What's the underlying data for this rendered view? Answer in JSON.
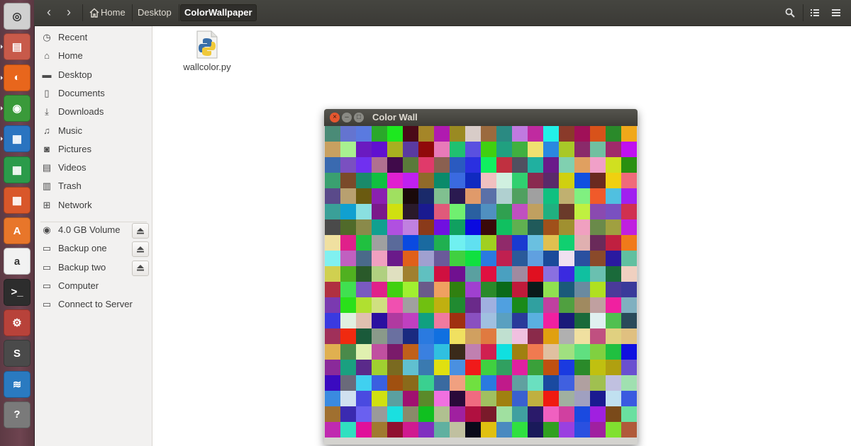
{
  "launcher": {
    "apps": [
      {
        "name": "ubuntu-logo-icon",
        "color": "#d0d0d0"
      },
      {
        "name": "file-manager-icon",
        "color": "#c85a4a"
      },
      {
        "name": "firefox-icon",
        "color": "#e8661c"
      },
      {
        "name": "chrome-icon",
        "color": "#3a9a3a"
      },
      {
        "name": "writer-icon",
        "color": "#2a74c0"
      },
      {
        "name": "calc-icon",
        "color": "#2b9b4a"
      },
      {
        "name": "impress-icon",
        "color": "#d9572a"
      },
      {
        "name": "software-center-icon",
        "color": "#e8762a"
      },
      {
        "name": "amazon-icon",
        "color": "#f2f2f2"
      },
      {
        "name": "terminal-icon",
        "color": "#2d2d2d"
      },
      {
        "name": "system-settings-icon",
        "color": "#b8423a"
      },
      {
        "name": "sublime-text-icon",
        "color": "#4a4a4a"
      },
      {
        "name": "system-monitor-icon",
        "color": "#2a7ac0"
      },
      {
        "name": "unknown-app-icon",
        "color": "#7a7a7a"
      }
    ]
  },
  "toolbar": {
    "breadcrumbs": [
      {
        "label": "Home"
      },
      {
        "label": "Desktop"
      },
      {
        "label": "ColorWallpaper"
      }
    ]
  },
  "sidebar": {
    "places": [
      {
        "label": "Recent",
        "icon": "clock-icon"
      },
      {
        "label": "Home",
        "icon": "home-icon"
      },
      {
        "label": "Desktop",
        "icon": "folder-icon"
      },
      {
        "label": "Documents",
        "icon": "document-icon"
      },
      {
        "label": "Downloads",
        "icon": "download-icon"
      },
      {
        "label": "Music",
        "icon": "music-icon"
      },
      {
        "label": "Pictures",
        "icon": "camera-icon"
      },
      {
        "label": "Videos",
        "icon": "film-icon"
      },
      {
        "label": "Trash",
        "icon": "trash-icon"
      },
      {
        "label": "Network",
        "icon": "network-icon"
      }
    ],
    "devices": [
      {
        "label": "4.0 GB Volume",
        "icon": "disk-icon"
      },
      {
        "label": "Backup one",
        "icon": "drive-icon"
      },
      {
        "label": "Backup two",
        "icon": "drive-icon"
      },
      {
        "label": "Computer",
        "icon": "drive-icon"
      },
      {
        "label": "Connect to Server",
        "icon": "server-icon"
      }
    ]
  },
  "main": {
    "files": [
      {
        "label": "wallcolor.py",
        "icon": "python-file-icon"
      }
    ]
  },
  "colorwall": {
    "title": "Color Wall",
    "grid_size": 20,
    "colors": [
      "#4a8b77",
      "#6474d0",
      "#5a7ae0",
      "#2aa82a",
      "#1de81f",
      "#4a0a18",
      "#a58628",
      "#b01ab0",
      "#9a8a22",
      "#d8ccc8",
      "#9b6a3e",
      "#2a8a82",
      "#c07ae0",
      "#c02aa0",
      "#22f0e8",
      "#8a3a2a",
      "#a01058",
      "#d8521a",
      "#2a8a2a",
      "#f0a81a",
      "#c8a060",
      "#a8f090",
      "#6a1ac0",
      "#6010d0",
      "#a8b020",
      "#5a3aa0",
      "#900a0a",
      "#e87ab8",
      "#20c070",
      "#5a50e0",
      "#40d010",
      "#20a080",
      "#40b040",
      "#f0e070",
      "#2a88e0",
      "#a8c828",
      "#8a2a6a",
      "#70c0a0",
      "#a02a6a",
      "#c010f0",
      "#3a6ab0",
      "#7a50c0",
      "#7030f0",
      "#b07090",
      "#400a4a",
      "#5a7a3a",
      "#e03a6a",
      "#8a6050",
      "#2a5ac0",
      "#2a30e0",
      "#10f060",
      "#c03040",
      "#505060",
      "#20b0a0",
      "#6a1a8a",
      "#80d0b0",
      "#e0a060",
      "#f0a0c8",
      "#d0e020",
      "#2a9010",
      "#3aa070",
      "#7a4a2a",
      "#1a8a6a",
      "#10c040",
      "#e020d0",
      "#c020f0",
      "#906a2a",
      "#0a8a6a",
      "#3a6ae0",
      "#102ac0",
      "#f0c0c0",
      "#d0f0e0",
      "#30d070",
      "#8a2a50",
      "#5a2a6a",
      "#d0d010",
      "#1050e0",
      "#6a2a20",
      "#f0d010",
      "#f06a7a",
      "#5a4a8a",
      "#b8a070",
      "#6a5a10",
      "#8a20b0",
      "#a0e060",
      "#1a0a0a",
      "#1a2a6a",
      "#80c090",
      "#2a1a50",
      "#e09a6a",
      "#5a70a8",
      "#b0d0d0",
      "#50a060",
      "#a0a0a0",
      "#10c080",
      "#c0b070",
      "#80f080",
      "#f05a2a",
      "#50c0e0",
      "#a020f0",
      "#3aa098",
      "#10a0d0",
      "#8ae0e0",
      "#7a1a8a",
      "#d0e010",
      "#2a1a2a",
      "#1a1a90",
      "#e05a7a",
      "#70f070",
      "#2a60a0",
      "#5090c0",
      "#30a050",
      "#c050c0",
      "#c0a060",
      "#20b080",
      "#6a3a2a",
      "#c0f040",
      "#8a4ab0",
      "#7a50c0",
      "#d03050",
      "#4a4a4a",
      "#506a2a",
      "#8a8a4a",
      "#10a090",
      "#b050e0",
      "#c080e0",
      "#8a3a1a",
      "#7010e0",
      "#10a060",
      "#0a0ae0",
      "#3a0a0a",
      "#10c060",
      "#60b050",
      "#205a5a",
      "#a0501a",
      "#a09030",
      "#f0a0c0",
      "#6a8a4a",
      "#a0a040",
      "#c020e0",
      "#f0e0a0",
      "#e0208a",
      "#20c040",
      "#a0a0a0",
      "#5a6a9a",
      "#0a4ae0",
      "#1a6aa0",
      "#20b050",
      "#70f0f0",
      "#60e0f0",
      "#a0d020",
      "#902a6a",
      "#1a3ad0",
      "#6ac0e0",
      "#e0c050",
      "#10d070",
      "#e0b0b0",
      "#6a2a5a",
      "#c02040",
      "#f07a1a",
      "#80f0f0",
      "#c060c0",
      "#4a6a8a",
      "#f0a0c0",
      "#6a1a8a",
      "#e0601a",
      "#a0a0d0",
      "#6a5a9a",
      "#40d040",
      "#10e040",
      "#2a7ae0",
      "#c02050",
      "#2a5a9a",
      "#60a0e0",
      "#1a4a9a",
      "#f0e0f0",
      "#2a50a0",
      "#8a4a2a",
      "#2a1aa0",
      "#60c0a0",
      "#d0d050",
      "#50b020",
      "#2a5a2a",
      "#b0d080",
      "#e0e0c0",
      "#a08030",
      "#60c0c0",
      "#d01040",
      "#701090",
      "#5aa0a0",
      "#e01040",
      "#4aa0c0",
      "#a08aa0",
      "#e01020",
      "#8a70e0",
      "#3a2ae0",
      "#10c0a0",
      "#6ac0b0",
      "#1a6a3a",
      "#f0d0c0",
      "#b03040",
      "#40e050",
      "#7a5ac0",
      "#e0208a",
      "#40d010",
      "#a0f030",
      "#6a5a8a",
      "#f0a060",
      "#308010",
      "#a040d0",
      "#2a8a2a",
      "#0a6a1a",
      "#c01a3a",
      "#0a1a1a",
      "#90e050",
      "#1a5a7a",
      "#6a8aa0",
      "#b0e020",
      "#4a3a9a",
      "#3a3a9a",
      "#7a3ab0",
      "#2ae01a",
      "#b0e030",
      "#d0e080",
      "#f050b0",
      "#a0a0a0",
      "#70c010",
      "#c0b010",
      "#208a30",
      "#6a2a8a",
      "#a0b0e0",
      "#50a0e0",
      "#1a8a1a",
      "#30a0a0",
      "#c040a0",
      "#50a040",
      "#a08a60",
      "#c0a0a0",
      "#f020a0",
      "#80b0c0",
      "#3a3ae0",
      "#e0f0e0",
      "#e0c0b0",
      "#2a10a0",
      "#b03aa0",
      "#c040c0",
      "#10a080",
      "#f07aa0",
      "#a03010",
      "#8a50c0",
      "#a0c0e0",
      "#5aa0c0",
      "#2a3a9a",
      "#5ab0e0",
      "#f020a0",
      "#1a1a7a",
      "#1a6a3a",
      "#e0f0f0",
      "#50c050",
      "#2a4a5a",
      "#a0305a",
      "#f02a10",
      "#1a5a3a",
      "#8a9a8a",
      "#6a70a0",
      "#1a2a80",
      "#2a7ae0",
      "#1070e0",
      "#f0e060",
      "#d0a060",
      "#e07a40",
      "#c0e0d0",
      "#f0c0e0",
      "#8a2a4a",
      "#e0a010",
      "#b0b0b0",
      "#f0e0a0",
      "#c05080",
      "#e0d080",
      "#e0c080",
      "#e0b050",
      "#4a8a4a",
      "#e0f0b0",
      "#c050a0",
      "#7a1a6a",
      "#c0601a",
      "#3a80e0",
      "#30c0e0",
      "#3a2a1a",
      "#c080b0",
      "#d02050",
      "#10e0e0",
      "#a08010",
      "#f07a50",
      "#e0c0a0",
      "#a0e080",
      "#60e080",
      "#80d040",
      "#20c040",
      "#1010e0",
      "#8a2a9a",
      "#1aa080",
      "#5a2a8a",
      "#a0d030",
      "#7a6a20",
      "#60c0d0",
      "#3a7ab0",
      "#e0e010",
      "#4a90e0",
      "#f01a1a",
      "#40d040",
      "#30a060",
      "#e020a0",
      "#3aa03a",
      "#c05010",
      "#1a3ae0",
      "#2a8a2a",
      "#c0c010",
      "#b0a010",
      "#6a50d0",
      "#3a0ac0",
      "#6a6a7a",
      "#40d0f0",
      "#3a60e0",
      "#a05010",
      "#8a6a1a",
      "#3ad090",
      "#3a6aa0",
      "#f0a080",
      "#70e040",
      "#2a7ae0",
      "#c01a8a",
      "#60a0a0",
      "#6ae0c0",
      "#1a4aa0",
      "#4060e0",
      "#b0a0a0",
      "#a0c050",
      "#c0c0e0",
      "#a0e0b0",
      "#3a8ae0",
      "#d0e0f0",
      "#4a4ae0",
      "#d0e010",
      "#5aa0a0",
      "#a01070",
      "#5a8a2a",
      "#f070e0",
      "#2a0a3a",
      "#f06a80",
      "#a0c060",
      "#a08010",
      "#3a60d0",
      "#c0b040",
      "#f01a10",
      "#a0b0a0",
      "#a0a0c0",
      "#1a1a90",
      "#c0e0f0",
      "#3a5ae0",
      "#a07030",
      "#3a2ab0",
      "#6a60f0",
      "#9a9a9a",
      "#1ae0e0",
      "#8a8a6a",
      "#10c020",
      "#b0c090",
      "#a020a0",
      "#b01040",
      "#7a1a2a",
      "#a0e0a0",
      "#40a0a0",
      "#2a1a6a",
      "#f060c0",
      "#d040a0",
      "#1a4ae0",
      "#a020e0",
      "#7a4a1a",
      "#6ae0a0",
      "#c02ab0",
      "#30e0c0",
      "#e0109a",
      "#a07a30",
      "#901030",
      "#d01a90",
      "#8030c0",
      "#60b0a0",
      "#c0c0a0",
      "#0a0a1a",
      "#e0c010",
      "#4a8ac0",
      "#30e040",
      "#1a1a5a",
      "#30a020",
      "#9a40e0",
      "#2a50e0",
      "#a020a0",
      "#80e030",
      "#b05a3a"
    ]
  }
}
